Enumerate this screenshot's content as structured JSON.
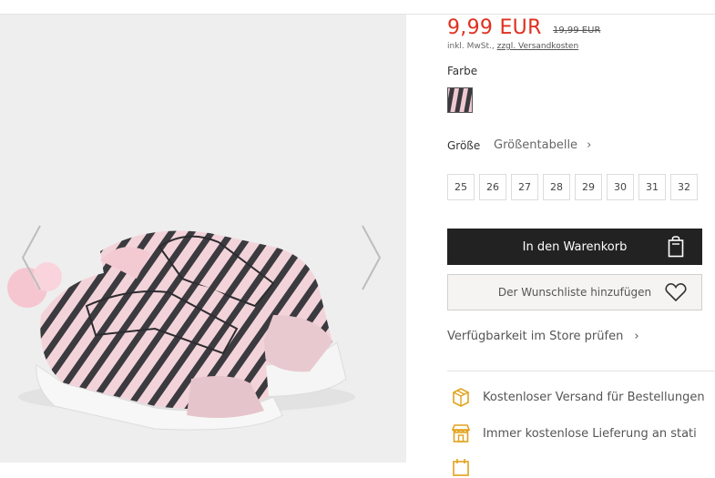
{
  "product": {
    "price": "9,99 EUR",
    "old_price": "19,99 EUR",
    "tax_prefix": "inkl. MwSt.,",
    "shipping_link": "zzgl. Versandkosten"
  },
  "color": {
    "label": "Farbe",
    "swatch_icon": "zebra-pattern"
  },
  "size": {
    "label": "Größe",
    "guide_label": "Größentabelle",
    "guide_chevron": "›",
    "options": [
      "25",
      "26",
      "27",
      "28",
      "29",
      "30",
      "31",
      "32"
    ]
  },
  "actions": {
    "add_to_cart": "In den Warenkorb",
    "add_to_wishlist": "Der Wunschliste hinzufügen"
  },
  "store": {
    "availability": "Verfügbarkeit im Store prüfen",
    "chevron": "›"
  },
  "benefits": [
    {
      "icon": "delivery-box-icon",
      "text": "Kostenloser Versand für Bestellungen"
    },
    {
      "icon": "store-icon",
      "text": "Immer kostenlose Lieferung an stati"
    }
  ],
  "colors": {
    "price_red": "#e0301e",
    "cart_button": "#222222",
    "icon_gold": "#e2a21c"
  }
}
